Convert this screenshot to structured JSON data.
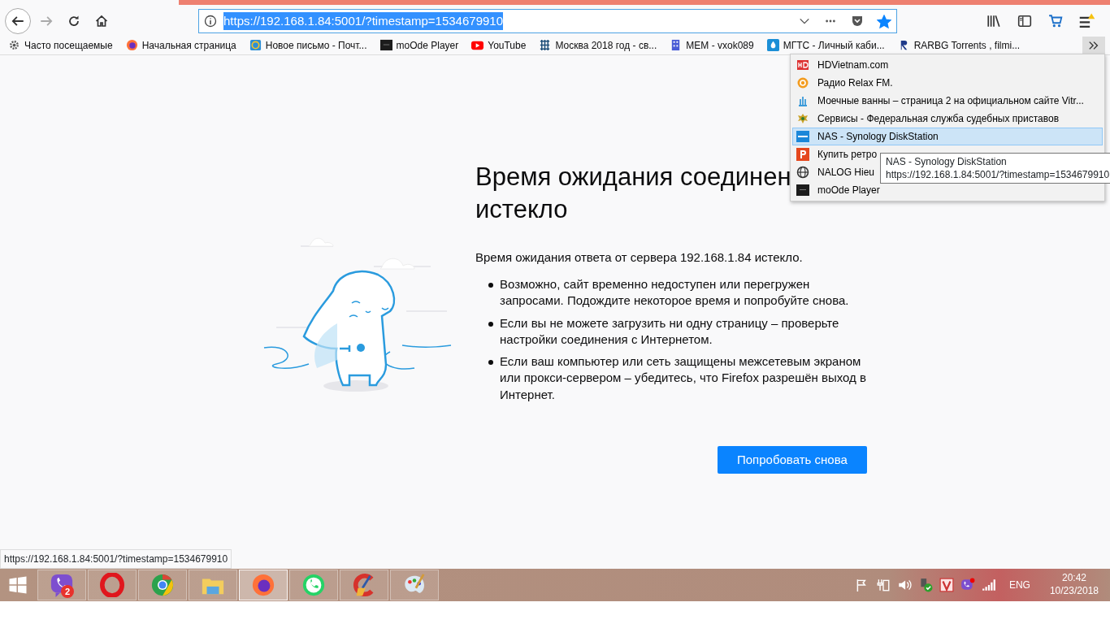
{
  "navigation": {
    "forward_disabled": true
  },
  "url_bar": {
    "url": "https://192.168.1.84:5001/?timestamp=1534679910",
    "selected": true,
    "bookmarked": true
  },
  "bookmarks": [
    {
      "label": "Часто посещаемые",
      "kind": "gear"
    },
    {
      "label": "Начальная страница",
      "kind": "firefox"
    },
    {
      "label": "Новое письмо - Почт...",
      "kind": "mail"
    },
    {
      "label": "moOde Player",
      "kind": "dark"
    },
    {
      "label": "YouTube",
      "kind": "youtube"
    },
    {
      "label": "Москва 2018 год - св...",
      "kind": "grid"
    },
    {
      "label": "МЕМ - vxok089",
      "kind": "building"
    },
    {
      "label": "МГТС - Личный каби...",
      "kind": "drop"
    },
    {
      "label": "RARBG Torrents , filmi...",
      "kind": "letter"
    }
  ],
  "bookmarks_menu": [
    {
      "label": "HDVietnam.com",
      "kind": "hd",
      "selected": false
    },
    {
      "label": "Радио Relax FM.",
      "kind": "radio",
      "selected": false
    },
    {
      "label": "Моечные ванны – страница 2 на официальном сайте Vitr...",
      "kind": "bath",
      "selected": false
    },
    {
      "label": "Сервисы - Федеральная служба судебных приставов",
      "kind": "emblem",
      "selected": false
    },
    {
      "label": "NAS - Synology DiskStation",
      "kind": "dsm",
      "selected": true
    },
    {
      "label": "Купить ретро",
      "kind": "letterp",
      "selected": false
    },
    {
      "label": "NALOG Hieu",
      "kind": "globe",
      "selected": false
    },
    {
      "label": "moOde Player",
      "kind": "dark",
      "selected": false
    }
  ],
  "tooltip": {
    "title": "NAS - Synology DiskStation",
    "url": "https://192.168.1.84:5001/?timestamp=1534679910"
  },
  "error": {
    "title_lines": [
      "Время ожидания соединен",
      "истекло"
    ],
    "intro": "Время ожидания ответа от сервера 192.168.1.84 истекло.",
    "bullets": [
      "Возможно, сайт временно недоступен или перегружен запросами. Подождите некоторое время и попробуйте снова.",
      "Если вы не можете загрузить ни одну страницу – проверьте настройки соединения с Интернетом.",
      "Если ваш компьютер или сеть защищены межсетевым экраном или прокси-сервером – убедитесь, что Firefox разрешён выход в Интернет."
    ],
    "button": "Попробовать снова"
  },
  "status_link": "https://192.168.1.84:5001/?timestamp=1534679910",
  "taskbar": {
    "apps": [
      {
        "kind": "viber",
        "selected": false,
        "badge": "2"
      },
      {
        "kind": "opera",
        "selected": false
      },
      {
        "kind": "chrome",
        "selected": false
      },
      {
        "kind": "folder",
        "selected": false
      },
      {
        "kind": "firefox",
        "selected": true
      },
      {
        "kind": "whatsapp",
        "selected": false
      },
      {
        "kind": "cleaner",
        "selected": false
      },
      {
        "kind": "palette",
        "selected": false
      }
    ],
    "tray": [
      {
        "kind": "flag"
      },
      {
        "kind": "battery"
      },
      {
        "kind": "volume"
      },
      {
        "kind": "usb"
      },
      {
        "kind": "vapp"
      },
      {
        "kind": "viber"
      },
      {
        "kind": "signal"
      }
    ],
    "language": "ENG",
    "time": "20:42",
    "date": "10/23/2018"
  }
}
